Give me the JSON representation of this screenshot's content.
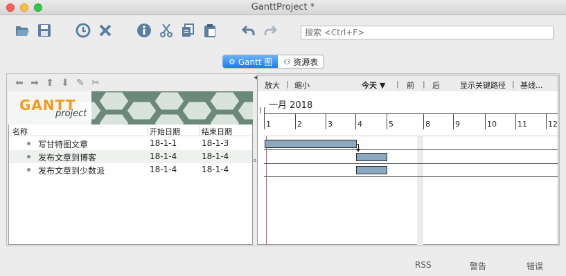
{
  "window": {
    "title": "GanttProject *"
  },
  "toolbar": {
    "icons": [
      "open-folder-icon",
      "save-icon",
      "clock-icon",
      "delete-icon",
      "info-icon",
      "cut-icon",
      "copy-icon",
      "paste-icon",
      "undo-icon",
      "redo-icon"
    ],
    "search_placeholder": "搜索 <Ctrl+F>"
  },
  "view_tabs": {
    "gantt": "Gantt 图",
    "resources": "资源表"
  },
  "tree": {
    "columns": {
      "name": "名称",
      "start": "开始日期",
      "end": "结束日期"
    },
    "rows": [
      {
        "name": "写甘特图文章",
        "start": "18-1-1",
        "end": "18-1-3"
      },
      {
        "name": "发布文章到博客",
        "start": "18-1-4",
        "end": "18-1-4"
      },
      {
        "name": "发布文章到少数派",
        "start": "18-1-4",
        "end": "18-1-4"
      }
    ],
    "logo": {
      "line1": "GANTT",
      "line2": "project"
    }
  },
  "chart": {
    "toolbar": {
      "zoom_in": "放大",
      "zoom_out": "缩小",
      "today": "今天 ▼",
      "prev": "前",
      "next": "后",
      "critical_path": "显示关键路径",
      "baseline": "基线..."
    },
    "month_label": "一月 2018",
    "day_ticks": [
      "1",
      "2",
      "3",
      "4",
      "5",
      "8",
      "9",
      "10",
      "11",
      "12"
    ]
  },
  "status": {
    "rss": "RSS",
    "warnings": "警告",
    "errors": "错误"
  },
  "colors": {
    "accent": "#157bf2",
    "bar": "#8aa9c0",
    "logo_orange": "#f39a1c"
  }
}
